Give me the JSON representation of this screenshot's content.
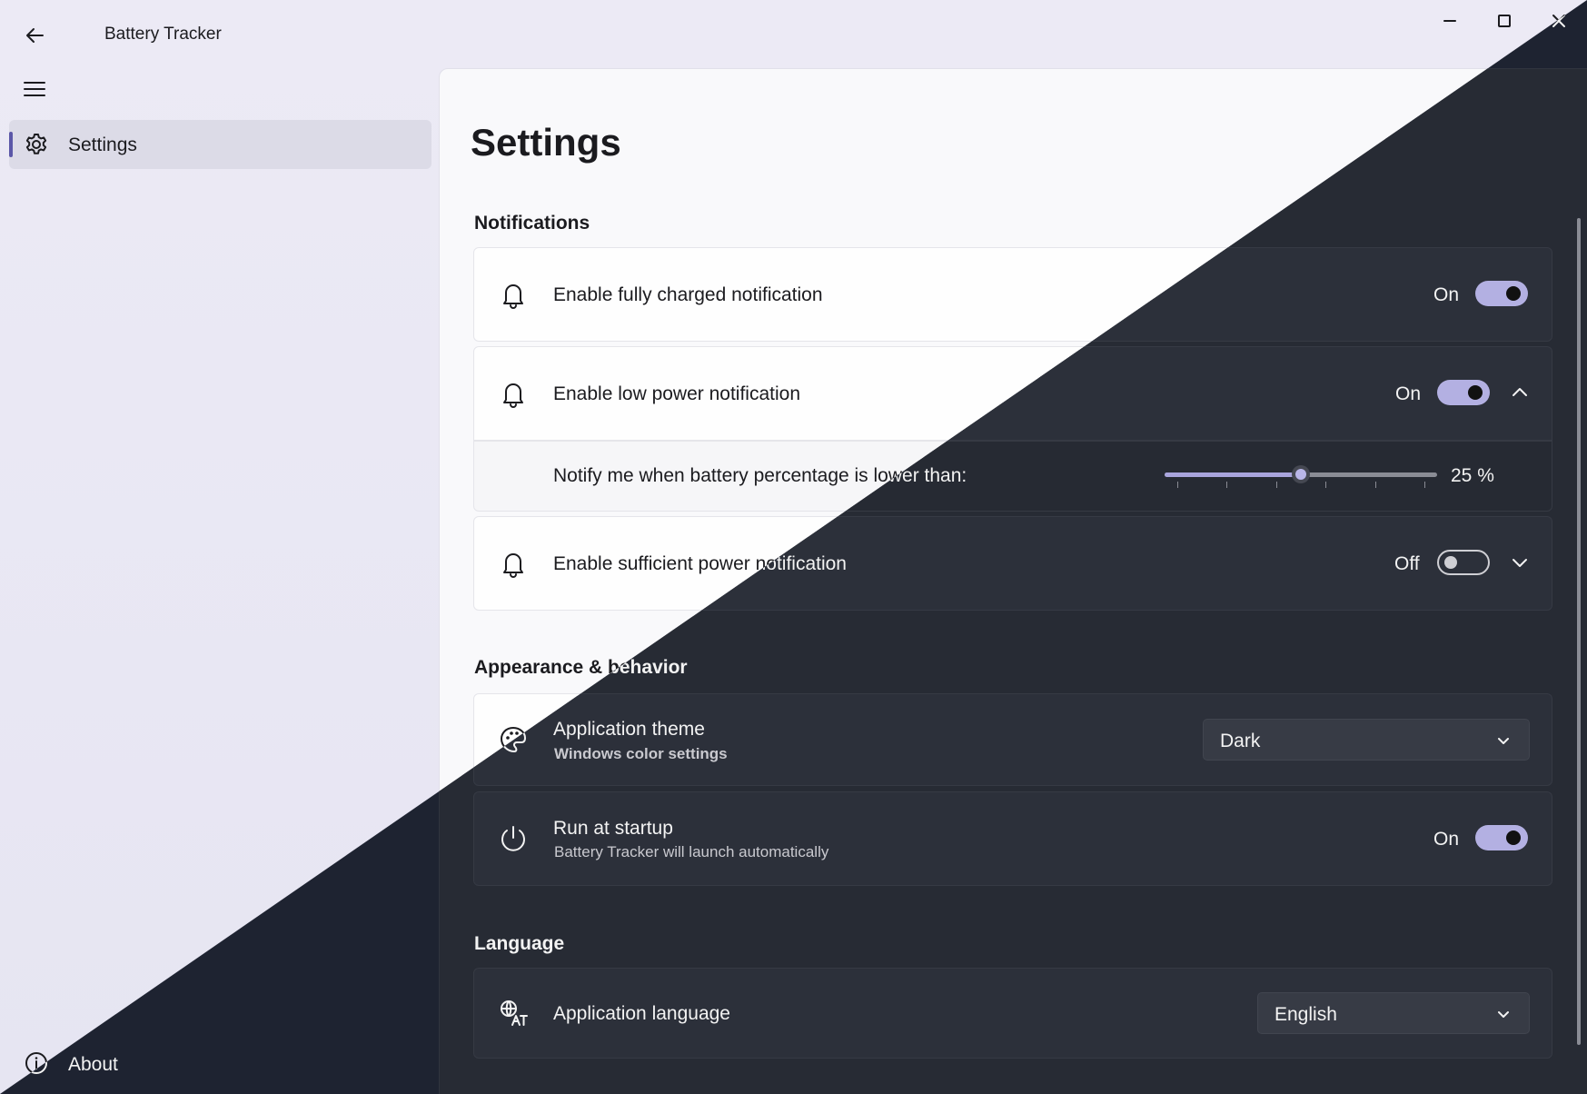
{
  "window": {
    "title": "Battery Tracker"
  },
  "nav": {
    "items": [
      {
        "label": "Settings",
        "icon": "gear-icon",
        "selected": true
      }
    ],
    "footer": {
      "label": "About",
      "icon": "info-icon"
    }
  },
  "page": {
    "title": "Settings"
  },
  "notifications": {
    "heading": "Notifications",
    "fully_charged": {
      "label": "Enable fully charged notification",
      "state": "On",
      "enabled": true,
      "icon": "bell-icon"
    },
    "low_power": {
      "label": "Enable low power notification",
      "state": "On",
      "enabled": true,
      "expanded": true,
      "icon": "bell-icon",
      "threshold": {
        "label": "Notify me when battery percentage is lower than:",
        "value": 25,
        "value_label": "25 %",
        "min": 0,
        "max": 50,
        "tick_count": 6
      }
    },
    "sufficient_power": {
      "label": "Enable sufficient power notification",
      "state": "Off",
      "enabled": false,
      "expanded": false,
      "icon": "bell-icon"
    }
  },
  "appearance": {
    "heading": "Appearance & behavior",
    "theme": {
      "label": "Application theme",
      "link": "Windows color settings",
      "value": "Dark",
      "icon": "palette-icon"
    },
    "startup": {
      "label": "Run at startup",
      "description": "Battery Tracker will launch automatically",
      "state": "On",
      "enabled": true,
      "icon": "power-icon"
    }
  },
  "language": {
    "heading": "Language",
    "app_language": {
      "label": "Application language",
      "value": "English",
      "icon": "translate-icon"
    }
  },
  "colors": {
    "accent_light": "#9d99d4",
    "accent_dark": "#b3b0e2",
    "dark_bg": "#1e2331"
  }
}
